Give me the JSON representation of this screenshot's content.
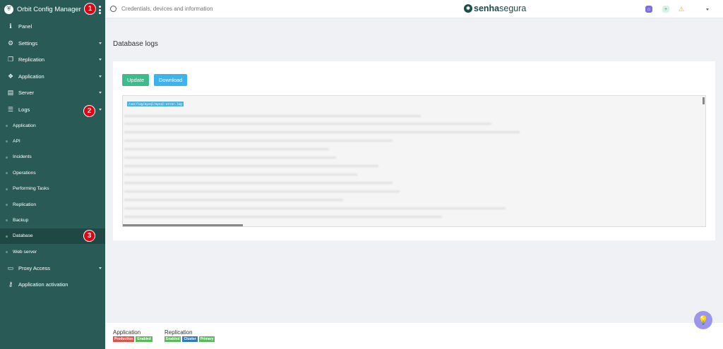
{
  "sidebar": {
    "title": "Orbit Config Manager",
    "items": [
      {
        "label": "Panel",
        "icon": "info-icon"
      },
      {
        "label": "Settings",
        "icon": "gears-icon"
      },
      {
        "label": "Replication",
        "icon": "copy-icon"
      },
      {
        "label": "Application",
        "icon": "cubes-icon"
      },
      {
        "label": "Server",
        "icon": "server-icon"
      },
      {
        "label": "Logs",
        "icon": "list-icon"
      }
    ],
    "logs_sub": [
      "Application",
      "API",
      "Incidents",
      "Operations",
      "Performing Tasks",
      "Replication",
      "Backup",
      "Database",
      "Web server"
    ],
    "bottom_items": [
      {
        "label": "Proxy Access",
        "icon": "monitor-icon"
      },
      {
        "label": "Application activation",
        "icon": "key-icon"
      }
    ]
  },
  "annotations": [
    "1",
    "2",
    "3"
  ],
  "topbar": {
    "search_placeholder": "Credentials, devices and information",
    "brand_bold": "senha",
    "brand_light": "segura"
  },
  "main": {
    "page_title": "Database logs",
    "update_label": "Update",
    "download_label": "Download",
    "log_path": "/var/log/mysql/mysql-error.log"
  },
  "footer": {
    "application_title": "Application",
    "application_tags": [
      {
        "text": "Production",
        "color": "#d9534f"
      },
      {
        "text": "Enabled",
        "color": "#5cb85c"
      }
    ],
    "replication_title": "Replication",
    "replication_tags": [
      {
        "text": "Enabled",
        "color": "#5cb85c"
      },
      {
        "text": "Cluster",
        "color": "#337ab7"
      },
      {
        "text": "Primary",
        "color": "#5cb85c"
      }
    ]
  },
  "colors": {
    "sidebar": "#2a5a56",
    "accent_green": "#3dbb8f",
    "accent_blue": "#3fb2ee",
    "badge": "#e3000f"
  }
}
